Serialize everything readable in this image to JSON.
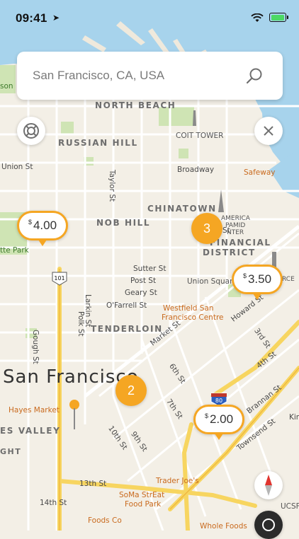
{
  "status_bar": {
    "time": "09:41"
  },
  "search": {
    "location": "San Francisco, CA, USA"
  },
  "markers": [
    {
      "kind": "price",
      "currency": "$",
      "amount": "4.00"
    },
    {
      "kind": "price",
      "currency": "$",
      "amount": "3.50"
    },
    {
      "kind": "price",
      "currency": "$",
      "amount": "2.00"
    },
    {
      "kind": "cluster",
      "count": "3"
    },
    {
      "kind": "cluster",
      "count": "2"
    }
  ],
  "map": {
    "districts": [
      "NORTH BEACH",
      "RUSSIAN HILL",
      "CHINATOWN",
      "NOB HILL",
      "FINANCIAL",
      "DISTRICT",
      "TENDERLOIN",
      "ES VALLEY"
    ],
    "city": "San Francisco",
    "streets": [
      "Union St",
      "Broadway",
      "Taylor St",
      "Sutter St",
      "Post St",
      "Geary St",
      "O'Farrell St",
      "Larkin St",
      "Polk St",
      "Gough St",
      "Market St",
      "6th St",
      "7th St",
      "10th St",
      "9th St",
      "13th St",
      "14th St",
      "Howard St",
      "3rd St",
      "4th St",
      "Brannan St",
      "Townsend St",
      "Kin",
      "St"
    ],
    "pois": [
      "COIT TOWER",
      "Safeway",
      "Union Square",
      "Westfield San",
      "Francisco Centre",
      "Hayes Market",
      "tte Park",
      "Trader Joe's",
      "SoMa StrEat",
      "Food Park",
      "Foods Co",
      "Whole Foods",
      "UCSF",
      "AMERICA",
      "PAMID",
      "NTER",
      "RCE",
      "son",
      "GHT"
    ],
    "highways": [
      "101",
      "80"
    ]
  },
  "colors": {
    "accent": "#f5a623",
    "water": "#a7d3ec",
    "land": "#f3efe6",
    "park": "#cfe4b4",
    "highway": "#f7d560"
  }
}
